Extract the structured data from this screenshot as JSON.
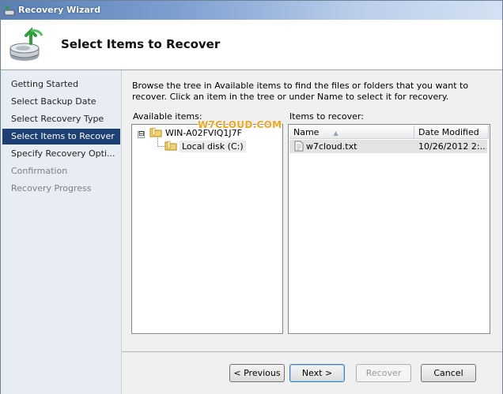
{
  "window": {
    "title": "Recovery Wizard",
    "icon": "wizard-icon"
  },
  "header": {
    "title": "Select Items to Recover",
    "icon": "backup-restore-icon"
  },
  "steps": [
    {
      "label": "Getting Started",
      "state": "normal"
    },
    {
      "label": "Select Backup Date",
      "state": "normal"
    },
    {
      "label": "Select Recovery Type",
      "state": "normal"
    },
    {
      "label": "Select Items to Recover",
      "state": "selected"
    },
    {
      "label": "Specify Recovery Opti...",
      "state": "normal"
    },
    {
      "label": "Confirmation",
      "state": "disabled"
    },
    {
      "label": "Recovery Progress",
      "state": "disabled"
    }
  ],
  "main": {
    "description": "Browse the tree in Available items to find the files or folders that you want to recover. Click an item in the tree or under Name to select it for recovery.",
    "available_label": "Available items:",
    "recover_label": "Items to recover:",
    "tree": {
      "expander": "⊟",
      "root": "WIN-A02FVIQ1J7F",
      "child": "Local disk (C:)"
    },
    "watermark": "W7CLOUD.COM",
    "list": {
      "columns": [
        "Name",
        "Date Modified"
      ],
      "rows": [
        {
          "name": "w7cloud.txt",
          "date": "10/26/2012 2:..."
        }
      ]
    }
  },
  "buttons": {
    "previous": "< Previous",
    "next": "Next >",
    "recover": "Recover",
    "cancel": "Cancel"
  },
  "colors": {
    "selected_step": "#1c3f74",
    "title_gradient_start": "#5a7fb3",
    "watermark": "#f2a51c"
  }
}
